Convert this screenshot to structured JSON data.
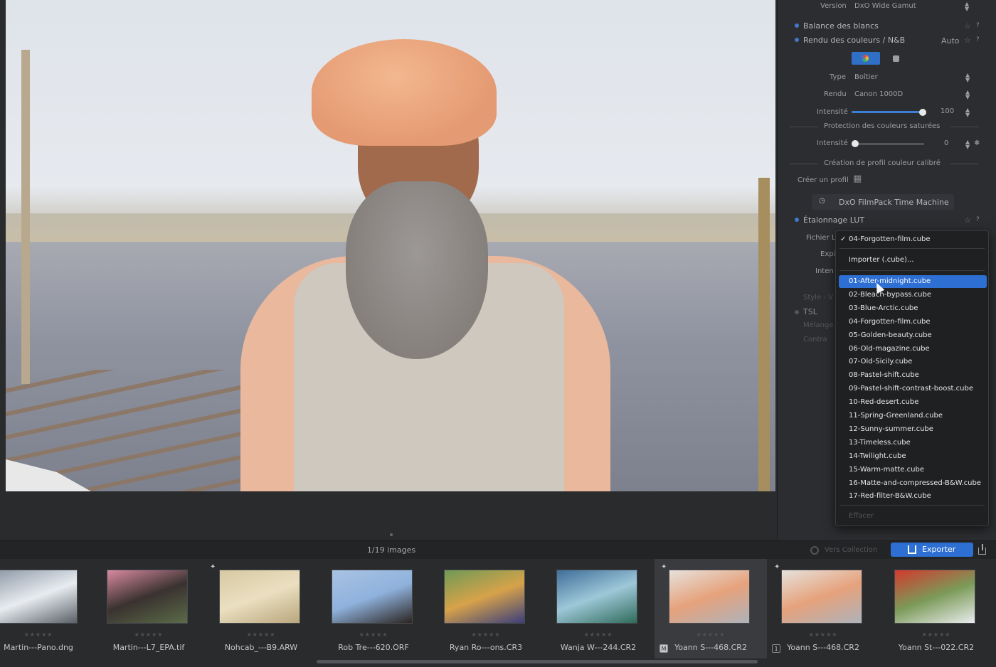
{
  "panel": {
    "version_label": "Version",
    "version_value": "DxO Wide Gamut",
    "white_balance": "Balance des blancs",
    "color_render": "Rendu des couleurs / N&B",
    "color_render_mode": "Auto",
    "type_label": "Type",
    "type_value": "Boîtier",
    "render_label": "Rendu",
    "render_value": "Canon 1000D",
    "intensity_label": "Intensité",
    "intensity_value": "100",
    "intensity_level": 1.0,
    "sat_protect_title": "Protection des couleurs saturées",
    "sat_intensity_label": "Intensité",
    "sat_intensity_value": "0",
    "sat_intensity_level": 0.0,
    "profile_title": "Création de profil couleur calibré",
    "create_profile_label": "Créer un profil",
    "filmpack_label": "DxO FilmPack Time Machine",
    "lut_title": "Étalonnage LUT",
    "file_label": "Fichier L",
    "expo_label": "Expi",
    "intens_label": "Inten",
    "tsl_label": "TSL",
    "tsl_partial": "Style - V",
    "mix_label": "Mélange",
    "contrast_label": "Contra"
  },
  "lut_menu": {
    "current": "04-Forgotten-film.cube",
    "import_label": "Importer (.cube)...",
    "items": [
      "01-After-midnight.cube",
      "02-Bleach-bypass.cube",
      "03-Blue-Arctic.cube",
      "04-Forgotten-film.cube",
      "05-Golden-beauty.cube",
      "06-Old-magazine.cube",
      "07-Old-Sicily.cube",
      "08-Pastel-shift.cube",
      "09-Pastel-shift-contrast-boost.cube",
      "10-Red-desert.cube",
      "11-Spring-Greenland.cube",
      "12-Sunny-summer.cube",
      "13-Timeless.cube",
      "14-Twilight.cube",
      "15-Warm-matte.cube",
      "16-Matte-and-compressed-B&W.cube",
      "17-Red-filter-B&W.cube"
    ],
    "highlighted_index": 0,
    "clear_label": "Effacer"
  },
  "status": {
    "image_count": "1/19 images",
    "collection_label": "Vers Collection",
    "export_label": "Exporter"
  },
  "filmstrip": [
    {
      "name": "Martin---Pano.dng",
      "stars": "★★★★★",
      "colors": [
        "#8f9aa8",
        "#e8ecf0",
        "#5a6068"
      ]
    },
    {
      "name": "Martin---L7_EPA.tif",
      "stars": "★★★★★",
      "colors": [
        "#d98aa0",
        "#3a3230",
        "#5b6b48"
      ]
    },
    {
      "name": "Nohcab_---B9.ARW",
      "stars": "★★★★★",
      "colors": [
        "#d7c9a2",
        "#eadfc0",
        "#b9a67c"
      ]
    },
    {
      "name": "Rob Tre---620.ORF",
      "stars": "★★★★★",
      "colors": [
        "#a9c2e3",
        "#8fb2dd",
        "#2b2521"
      ]
    },
    {
      "name": "Ryan Ro---ons.CR3",
      "stars": "★★★★★",
      "colors": [
        "#6e9a56",
        "#d7a24a",
        "#3a3e7a"
      ]
    },
    {
      "name": "Wanja W---244.CR2",
      "stars": "★★★★★",
      "colors": [
        "#3f6f9a",
        "#9ec7d8",
        "#2f6b5a"
      ]
    },
    {
      "name": "Yoann S---468.CR2",
      "stars": "★★★★★",
      "colors": [
        "#e6e2dc",
        "#e6a27c",
        "#aeb2ba"
      ]
    },
    {
      "name": "Yoann S---468.CR2",
      "stars": "★★★★★",
      "colors": [
        "#e6e2dc",
        "#e6a27c",
        "#aeb2ba"
      ]
    },
    {
      "name": "Yoann St---022.CR2",
      "stars": "★★★★★",
      "colors": [
        "#d23a2e",
        "#7b9a58",
        "#e9ecee"
      ]
    }
  ],
  "filmstrip_meta": {
    "selected_index": 6,
    "badge_m": "M",
    "badge_1": "1"
  },
  "colors": {
    "accent": "#2d6fd3",
    "panel_bg": "#2c2d30",
    "menu_bg": "#1f2022"
  }
}
